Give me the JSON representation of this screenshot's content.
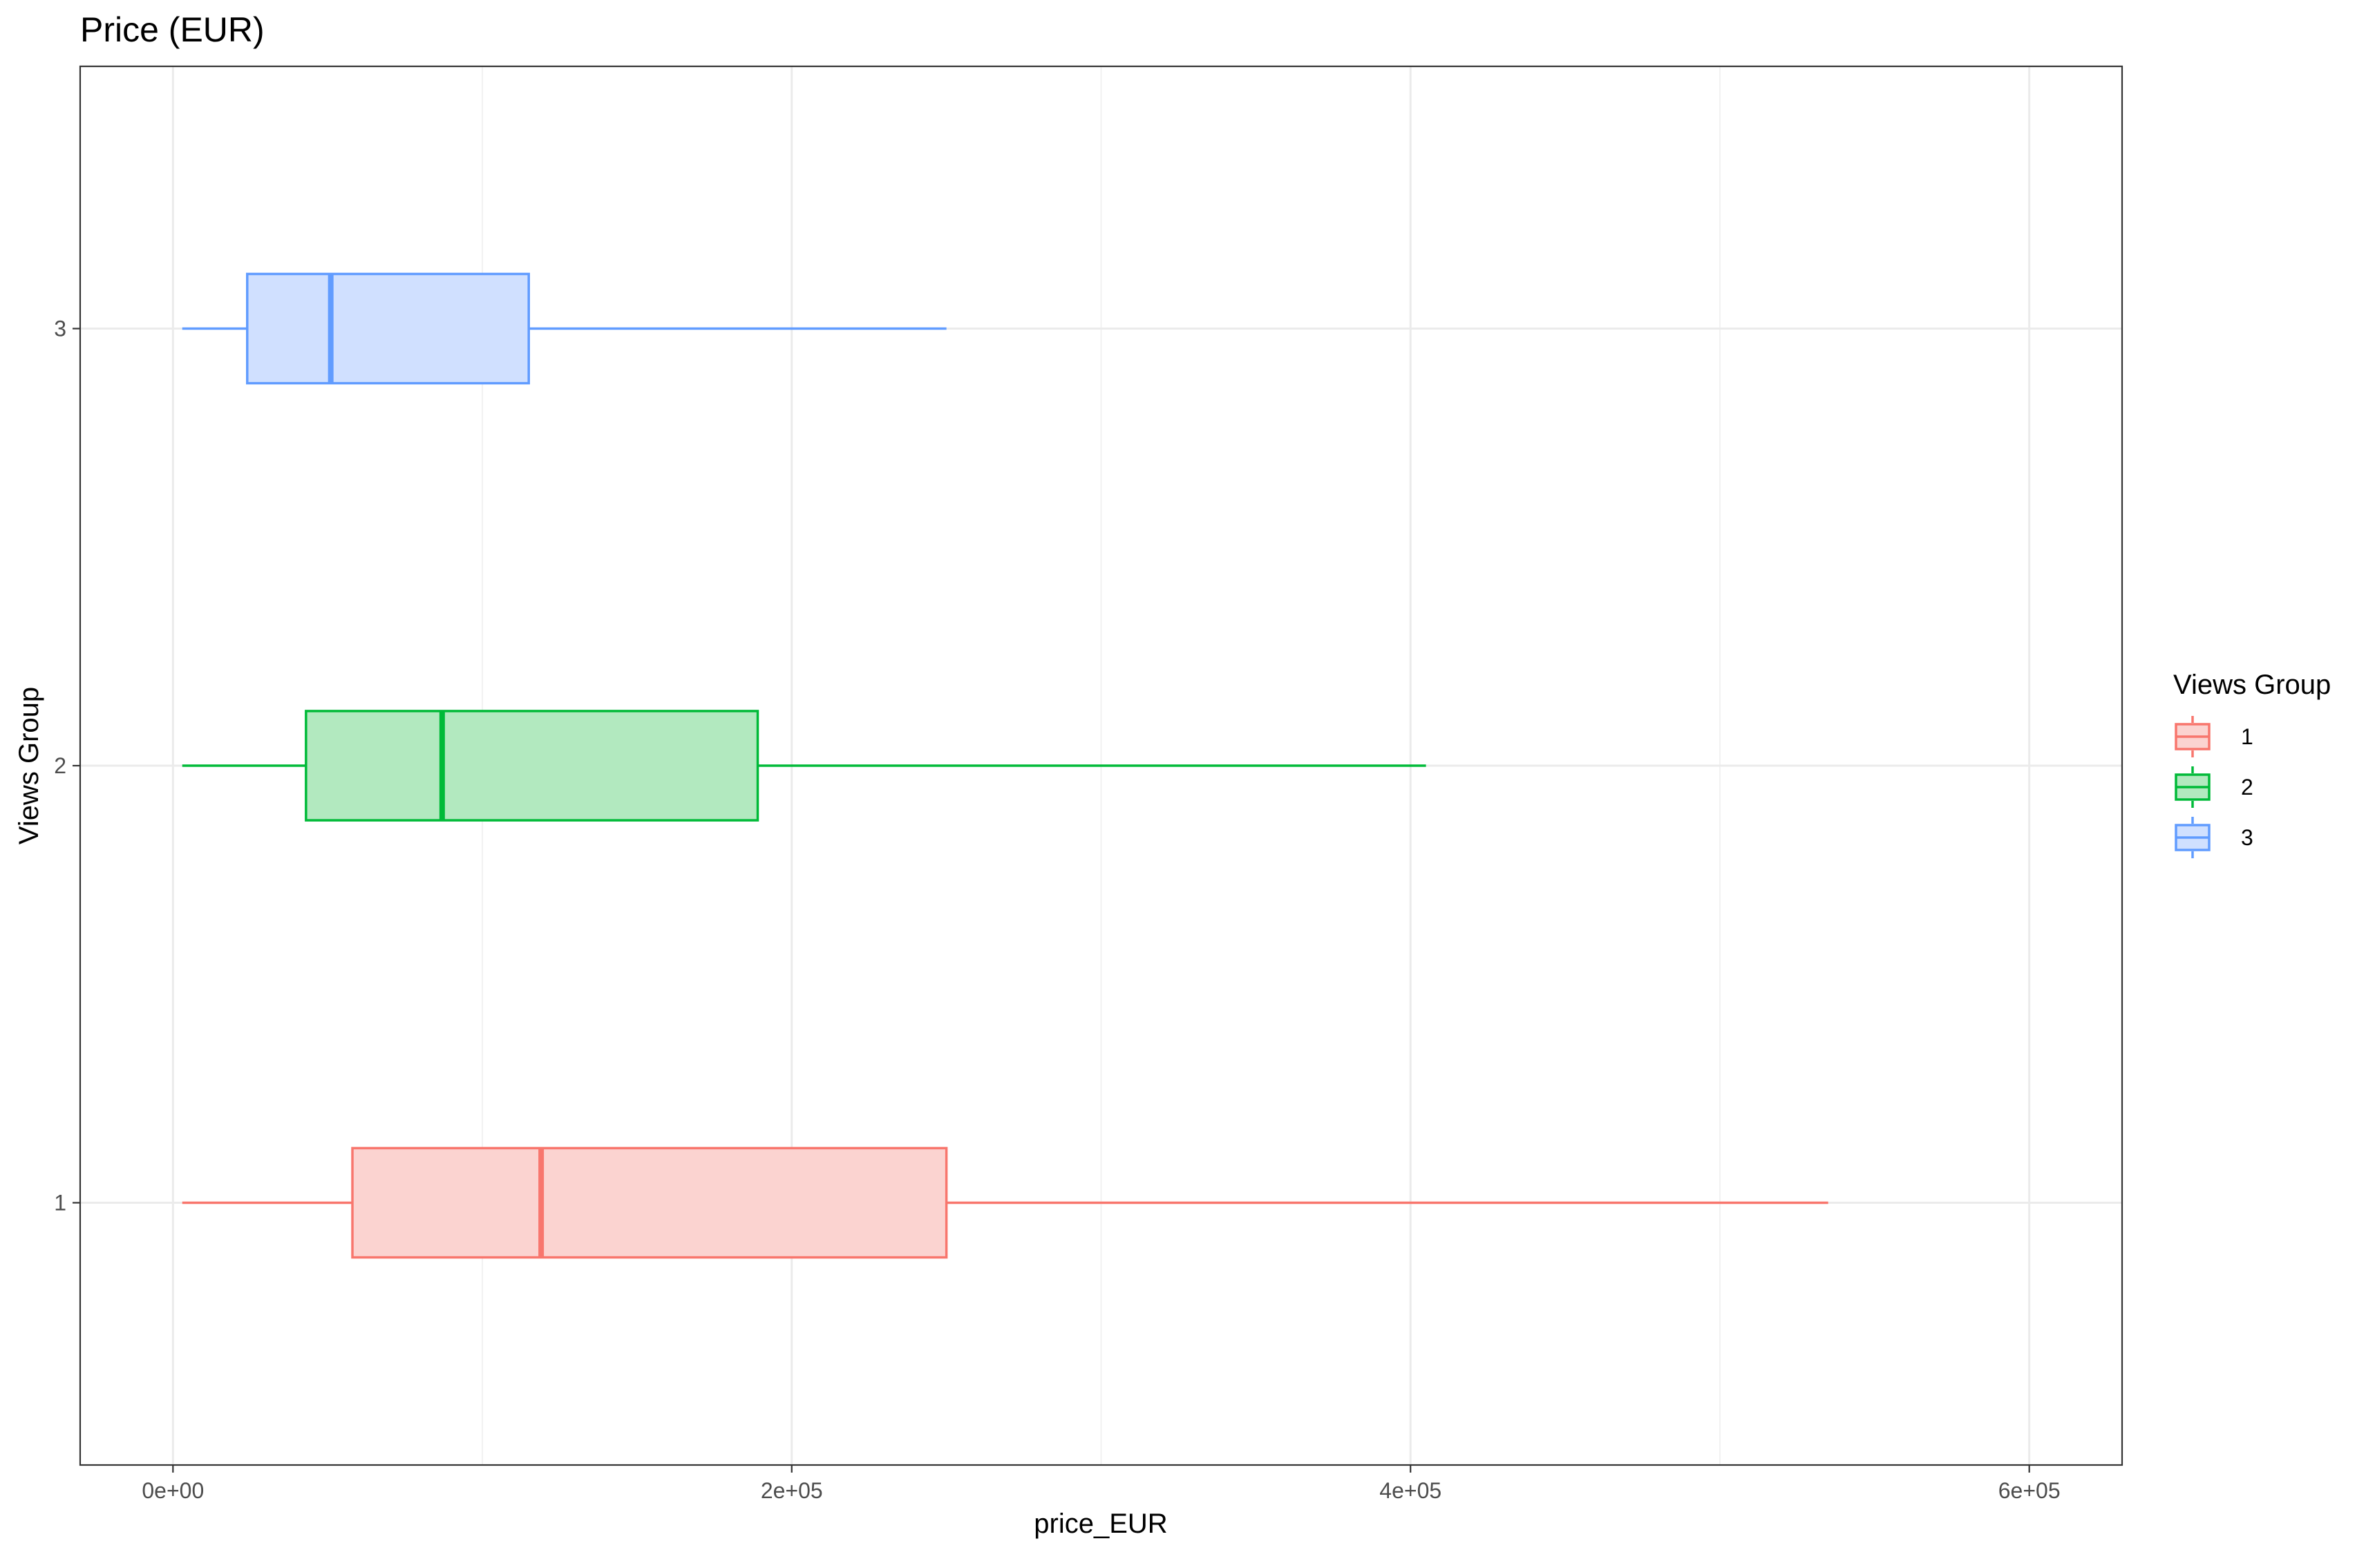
{
  "chart_data": {
    "type": "boxplot",
    "orientation": "horizontal",
    "title": "Price (EUR)",
    "xlabel": "price_EUR",
    "ylabel": "Views Group",
    "xlim": [
      -30000,
      630000
    ],
    "ylim": [
      0.4,
      3.6
    ],
    "x_ticks": [
      0,
      200000,
      400000,
      600000
    ],
    "x_tick_labels": [
      "0e+00",
      "2e+05",
      "4e+05",
      "6e+05"
    ],
    "x_minor_ticks": [
      100000,
      300000,
      500000
    ],
    "y_ticks": [
      1,
      2,
      3
    ],
    "y_tick_labels": [
      "1",
      "2",
      "3"
    ],
    "grid": true,
    "legend": {
      "title": "Views Group",
      "position": "right"
    },
    "series": [
      {
        "name": "1",
        "y": 1,
        "whisker_low": 3000,
        "q1": 58000,
        "median": 119000,
        "q3": 250000,
        "whisker_high": 535000,
        "color": "#F8766D",
        "fill": "#FBD3D0"
      },
      {
        "name": "2",
        "y": 2,
        "whisker_low": 3000,
        "q1": 43000,
        "median": 87000,
        "q3": 189000,
        "whisker_high": 405000,
        "color": "#00BA38",
        "fill": "#B2E9BF"
      },
      {
        "name": "3",
        "y": 3,
        "whisker_low": 3000,
        "q1": 24000,
        "median": 51000,
        "q3": 115000,
        "whisker_high": 250000,
        "color": "#619CFF",
        "fill": "#D0E0FF"
      }
    ]
  }
}
